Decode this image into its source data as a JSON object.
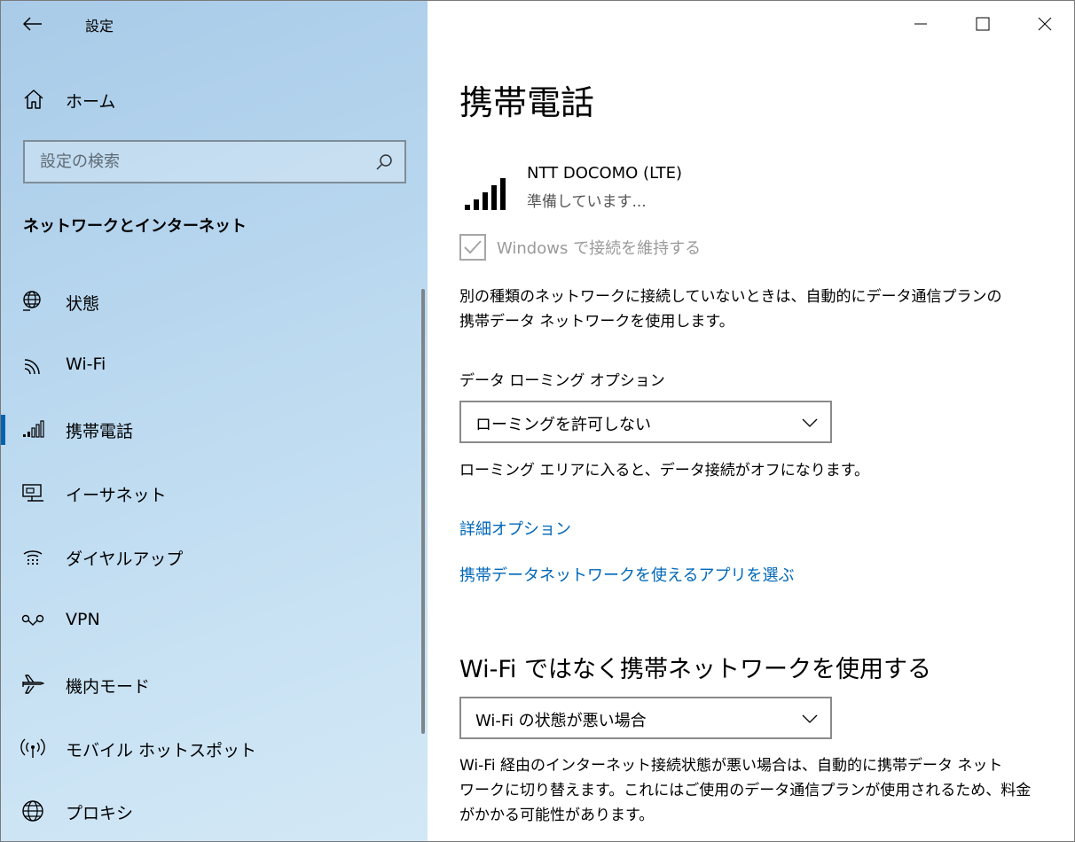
{
  "window": {
    "title": "設定"
  },
  "sidebar": {
    "home_label": "ホーム",
    "search_placeholder": "設定の検索",
    "section_heading": "ネットワークとインターネット",
    "items": [
      {
        "label": "状態",
        "icon": "globe-status-icon"
      },
      {
        "label": "Wi-Fi",
        "icon": "wifi-icon"
      },
      {
        "label": "携帯電話",
        "icon": "cellular-icon",
        "active": true
      },
      {
        "label": "イーサネット",
        "icon": "ethernet-icon"
      },
      {
        "label": "ダイヤルアップ",
        "icon": "dialup-icon"
      },
      {
        "label": "VPN",
        "icon": "vpn-icon"
      },
      {
        "label": "機内モード",
        "icon": "airplane-icon"
      },
      {
        "label": "モバイル ホットスポット",
        "icon": "hotspot-icon"
      },
      {
        "label": "プロキシ",
        "icon": "globe-icon"
      }
    ]
  },
  "main": {
    "title": "携帯電話",
    "network": {
      "name": "NTT DOCOMO (LTE)",
      "status": "準備しています..."
    },
    "keep_connected": {
      "label": "Windows で接続を維持する",
      "checked": true,
      "disabled": true
    },
    "description1_line1": "別の種類のネットワークに接続していないときは、自動的にデータ通信プランの",
    "description1_line2": "携帯データ ネットワークを使用します。",
    "roaming": {
      "label": "データ ローミング オプション",
      "selected": "ローミングを許可しない",
      "note": "ローミング エリアに入ると、データ接続がオフになります。"
    },
    "links": {
      "advanced": "詳細オプション",
      "choose_apps": "携帯データネットワークを使えるアプリを選ぶ"
    },
    "prefer_cellular": {
      "heading": "Wi-Fi ではなく携帯ネットワークを使用する",
      "selected": "Wi-Fi の状態が悪い場合",
      "note_line1": "Wi-Fi 経由のインターネット接続状態が悪い場合は、自動的に携帯データ ネット",
      "note_line2": "ワークに切り替えます。これにはご使用のデータ通信プランが使用されるため、料金",
      "note_line3": "がかかる可能性があります。"
    }
  }
}
